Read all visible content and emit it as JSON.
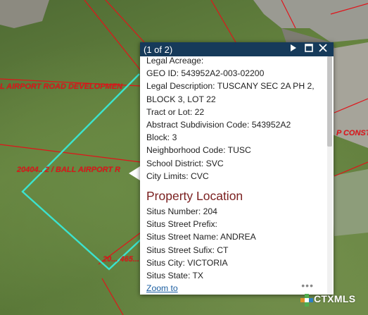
{
  "map": {
    "labels": {
      "road_1": "L AIRPORT ROAD DEVELOPMEN",
      "road_2": "20404.. 2 / BALL AIRPORT R",
      "road_3": "20... 465...",
      "right_label": "P CONST"
    },
    "colors": {
      "parcel_outline": "#3be3cf",
      "lot_lines": "#e0141a"
    }
  },
  "popup": {
    "title": "(1 of 2)",
    "icons": {
      "next": "play-icon",
      "maximize": "maximize-icon",
      "close": "close-icon"
    },
    "fields": [
      "Legal Acreage:",
      "GEO ID: 543952A2-003-02200",
      "Legal Description: TUSCANY SEC 2A PH 2, BLOCK 3, LOT 22",
      "Tract or Lot: 22",
      "Abstract Subdivision Code: 543952A2",
      "Block: 3",
      "Neighborhood Code: TUSC",
      "School District: SVC",
      "City Limits: CVC"
    ],
    "section_title": "Property Location",
    "location_fields": [
      "Situs Number: 204",
      "Situs Street Prefix:",
      "Situs Street Name: ANDREA",
      "Situs Street Sufix: CT",
      "Situs City: VICTORIA",
      "Situs State: TX"
    ],
    "zoom_link": "Zoom to",
    "more_icon": "ellipsis-icon"
  },
  "watermark": {
    "brand": "CTXMLS",
    "colors": [
      "#4fae4e",
      "#e0932b",
      "#2d7fc1"
    ]
  }
}
